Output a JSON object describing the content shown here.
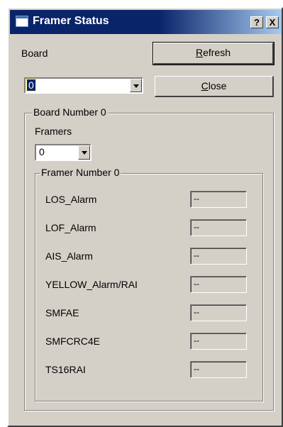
{
  "window": {
    "title": "Framer Status"
  },
  "titlebar": {
    "help_label": "?",
    "close_label": "X"
  },
  "board": {
    "label": "Board",
    "selected": "0",
    "refresh_first": "R",
    "refresh_rest": "efresh",
    "close_first": "C",
    "close_rest": "lose"
  },
  "board_group": {
    "title": "Board Number 0",
    "framers_label": "Framers",
    "framers_selected": "0"
  },
  "framer_group": {
    "title": "Framer Number 0",
    "rows": [
      {
        "label": "LOS_Alarm",
        "value": "--"
      },
      {
        "label": "LOF_Alarm",
        "value": "--"
      },
      {
        "label": "AIS_Alarm",
        "value": "--"
      },
      {
        "label": "YELLOW_Alarm/RAI",
        "value": "--"
      },
      {
        "label": "SMFAE",
        "value": "--"
      },
      {
        "label": "SMFCRC4E",
        "value": "--"
      },
      {
        "label": "TS16RAI",
        "value": "--"
      }
    ]
  }
}
